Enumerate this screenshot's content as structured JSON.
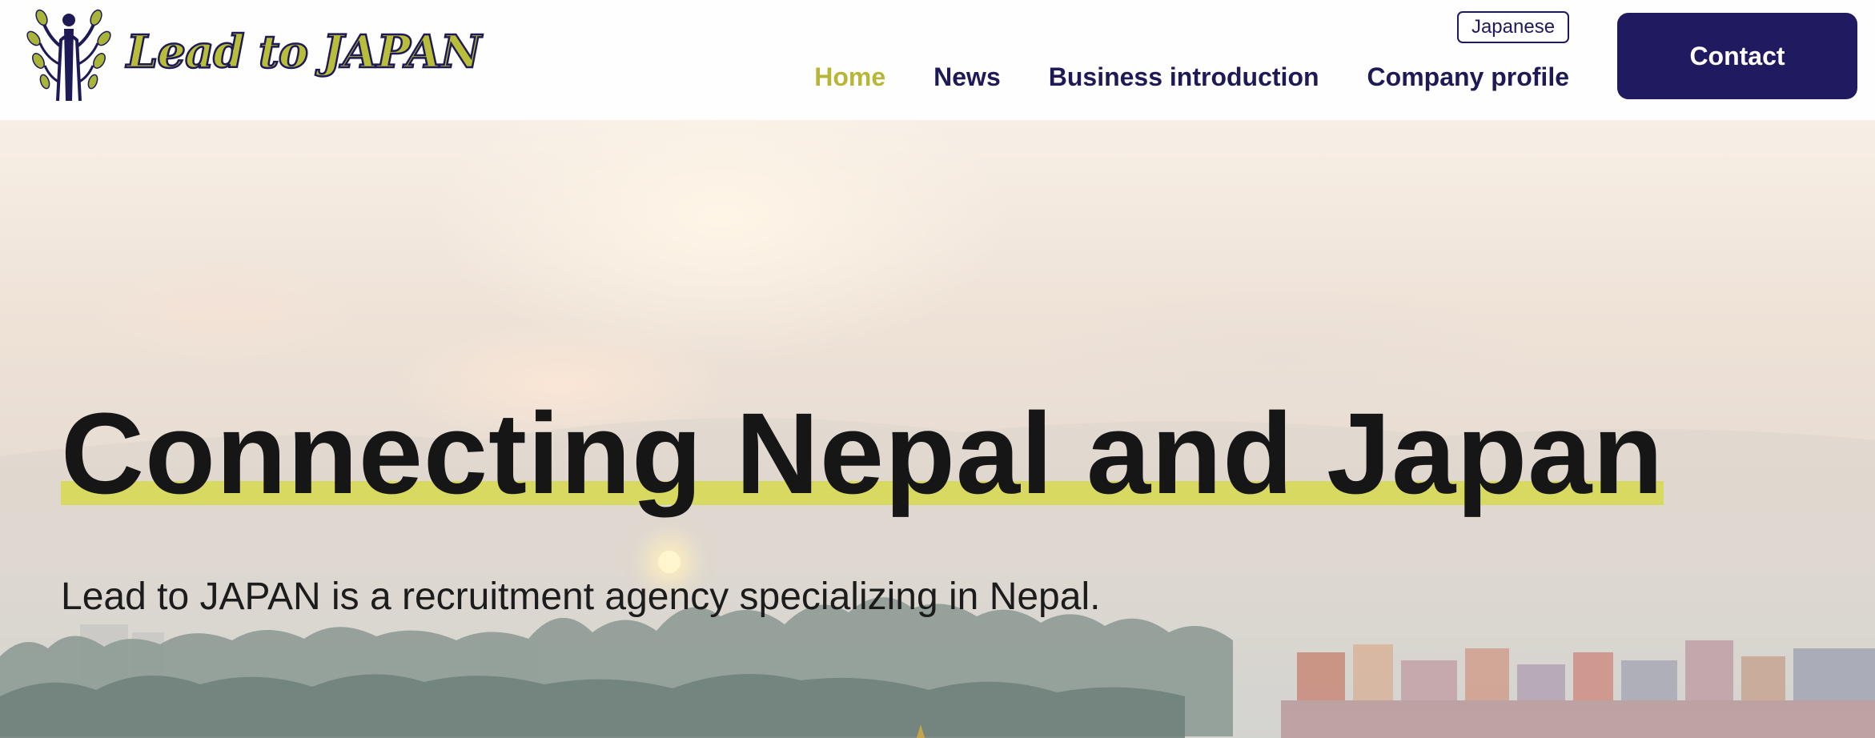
{
  "header": {
    "logo_text": "Lead to JAPAN",
    "language_button": "Japanese",
    "nav": [
      "Home",
      "News",
      "Business introduction",
      "Company profile"
    ],
    "active_nav": "Home",
    "contact_button": "Contact"
  },
  "hero": {
    "headline": "Connecting Nepal and Japan",
    "subheadline": "Lead to JAPAN is a recruitment agency specializing in Nepal."
  },
  "colors": {
    "brand_navy": "#201a60",
    "accent_olive": "#b8b636",
    "highlight_yellow": "#d8d960"
  },
  "icons": [
    "logo-tree-figure-icon"
  ]
}
